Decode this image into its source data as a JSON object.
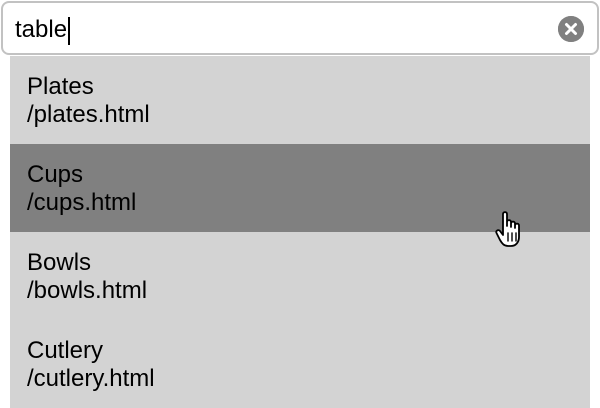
{
  "search": {
    "value": "table",
    "clear_icon": "clear-circle-x-icon"
  },
  "results": [
    {
      "title": "Plates",
      "url": "/plates.html",
      "highlighted": false
    },
    {
      "title": "Cups",
      "url": "/cups.html",
      "highlighted": true
    },
    {
      "title": "Bowls",
      "url": "/bowls.html",
      "highlighted": false
    },
    {
      "title": "Cutlery",
      "url": "/cutlery.html",
      "highlighted": false
    }
  ],
  "cursor": {
    "icon": "pointer-hand-icon"
  },
  "colors": {
    "results_background": "#d3d3d3",
    "highlight_background": "#808080",
    "clear_button": "#808080"
  }
}
